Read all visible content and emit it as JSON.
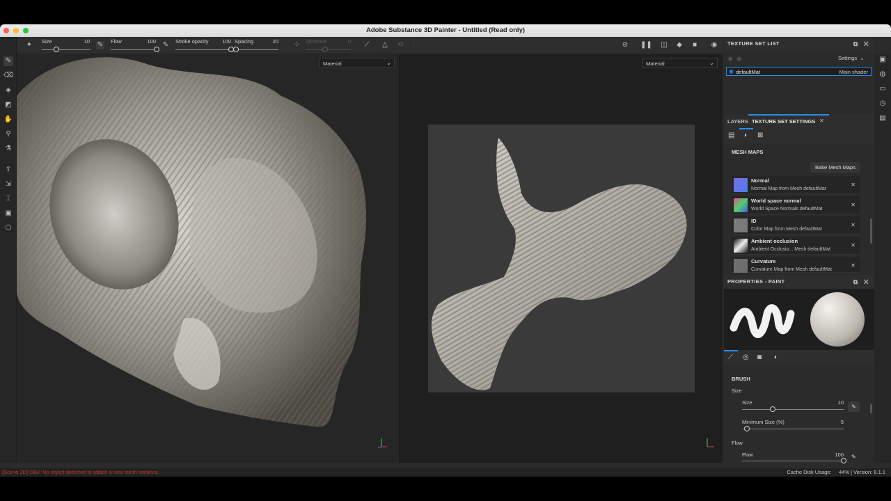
{
  "window": {
    "title": "Adobe Substance 3D Painter - Untitled (Read only)"
  },
  "toolbar": {
    "size_label": "Size",
    "size_value": "10",
    "size_fraction": 0.3,
    "flow_label": "Flow",
    "flow_value": "100",
    "flow_fraction": 1.0,
    "stroke_opacity_label": "Stroke opacity",
    "stroke_opacity_value": "100",
    "stroke_opacity_fraction": 1.0,
    "spacing_label": "Spacing",
    "spacing_value": "20",
    "spacing_fraction": 0.03,
    "distance_label": "Distance",
    "distance_value": "0"
  },
  "viewport_left": {
    "mode": "Material"
  },
  "viewport_right": {
    "mode": "Material"
  },
  "texture_set_list": {
    "title": "TEXTURE SET LIST",
    "settings_label": "Settings",
    "items": [
      {
        "name": "defaultMat",
        "shader": "Main shader"
      }
    ]
  },
  "tabs": {
    "layers": "LAYERS",
    "texture_set_settings": "TEXTURE SET SETTINGS"
  },
  "mesh_maps": {
    "title": "MESH MAPS",
    "bake_button": "Bake Mesh Maps",
    "items": [
      {
        "name": "Normal",
        "desc": "Normal Map from Mesh defaultMat"
      },
      {
        "name": "World space normal",
        "desc": "World Space Normals defaultMat"
      },
      {
        "name": "ID",
        "desc": "Color Map from Mesh defaultMat"
      },
      {
        "name": "Ambient occlusion",
        "desc": "Ambient Occlusio... Mesh defaultMat"
      },
      {
        "name": "Curvature",
        "desc": "Curvature Map from Mesh defaultMat"
      }
    ]
  },
  "properties": {
    "title": "PROPERTIES - PAINT",
    "brush_section": "BRUSH",
    "size_group": "Size",
    "size_label": "Size",
    "size_value": "10",
    "size_fraction": 0.3,
    "min_size_label": "Minimum Size (%)",
    "min_size_value": "5",
    "min_size_fraction": 0.05,
    "flow_group": "Flow",
    "flow_label": "Flow",
    "flow_value": "100",
    "flow_fraction": 1.0
  },
  "status": {
    "error": "[Scene 3D] OBJ: No object detected to attach a new mesh instance.",
    "cache_label": "Cache Disk Usage:",
    "cache_value": "44%",
    "version": "| Version: 8.1.1"
  },
  "colors": {
    "accent": "#2d8ceb",
    "error": "#c0392b",
    "background": "#2b2b2b"
  }
}
